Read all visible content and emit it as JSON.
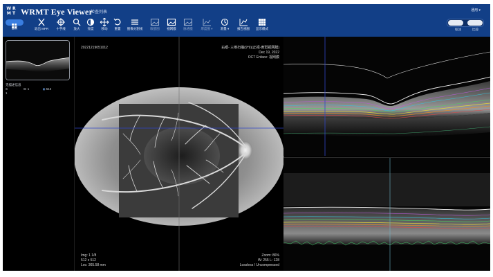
{
  "app": {
    "logo_text": "WRMT",
    "title": "WRMT Eye Viewer",
    "subtitle": "检查列表",
    "user_menu": "通用 ▾"
  },
  "toolbar": {
    "items": [
      {
        "key": "home",
        "label": "当前",
        "icon": "grid-icon"
      },
      {
        "key": "close-mpr",
        "label": "退出 MPR",
        "icon": "close-icon"
      },
      {
        "key": "crosshair",
        "label": "十字线",
        "icon": "crosshair-icon"
      },
      {
        "key": "zoom",
        "label": "放大",
        "icon": "search-icon"
      },
      {
        "key": "contrast",
        "label": "亮度",
        "icon": "contrast-icon"
      },
      {
        "key": "pan",
        "label": "移动",
        "icon": "move-icon"
      },
      {
        "key": "reset",
        "label": "重置",
        "icon": "undo-icon"
      },
      {
        "key": "segmentation",
        "label": "图像分割线",
        "icon": "lines-icon"
      },
      {
        "key": "enface",
        "label": "眼底图",
        "icon": "image-icon"
      },
      {
        "key": "oct",
        "label": "视网膜",
        "icon": "image-icon"
      },
      {
        "key": "volume",
        "label": "脉络膜",
        "icon": "image-icon"
      },
      {
        "key": "thickness",
        "label": "厚度图 ▾",
        "icon": "chart-icon"
      },
      {
        "key": "measure",
        "label": "测量 ▾",
        "icon": "measure-icon"
      },
      {
        "key": "report",
        "label": "报告视图",
        "icon": "report-icon"
      },
      {
        "key": "layout",
        "label": "显示模式",
        "icon": "layout-icon"
      }
    ],
    "toggle_left_label": "标注",
    "toggle_right_label": "比较"
  },
  "thumbnail": {
    "title": "无描述信息",
    "row1_left": "S",
    "row1_mid": "B: 1",
    "row1_right": "512",
    "row2_left": "1"
  },
  "enface": {
    "top_left": "20221219051012",
    "top_right_line1": "右眼- 三维扫描(9*9)(正视-黄斑视网膜)",
    "top_right_line2": "Dec 19, 2022",
    "top_right_line3": "OCT Enface: 视网膜",
    "bottom_left_line1": "Img: 1 1/8",
    "bottom_left_line2": "512 x 512",
    "bottom_left_line3": "Loc: 365.58 mm",
    "bottom_right_line1": "Zoom: 86%",
    "bottom_right_line2": "W: 255 L: 128",
    "bottom_right_line3": "Lossless / Uncompressed"
  },
  "colors": {
    "header_bg": "#123f87",
    "accent": "#3a7ee0",
    "crosshair_blue": "#2f46c9",
    "ilm_white": "#f1f1f1"
  }
}
